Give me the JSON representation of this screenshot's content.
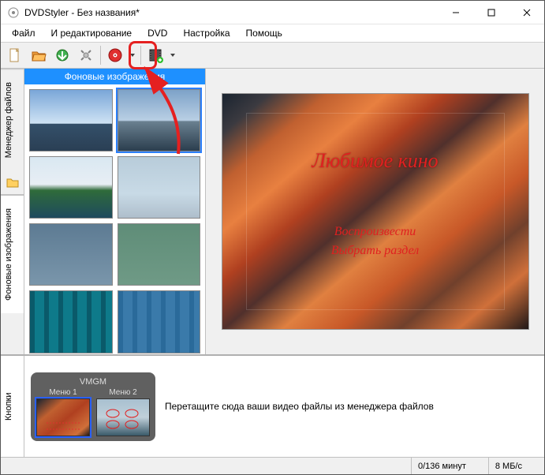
{
  "window": {
    "title": "DVDStyler - Без названия*"
  },
  "menu": {
    "items": [
      "Файл",
      "И редактирование",
      "DVD",
      "Настройка",
      "Помощь"
    ]
  },
  "toolbar": {
    "buttons": [
      {
        "name": "new-project-icon",
        "color": "#f0e0b0"
      },
      {
        "name": "open-project-icon",
        "color": "#f09030"
      },
      {
        "name": "save-project-icon",
        "color": "#40a040"
      },
      {
        "name": "settings-icon",
        "color": "#909090"
      },
      {
        "name": "burn-disc-icon",
        "color": "#d02020"
      },
      {
        "name": "add-video-icon",
        "color": "#505050"
      }
    ]
  },
  "sidebar_tabs": {
    "items": [
      {
        "label": "Менеджер файлов",
        "active": false
      },
      {
        "label": "",
        "active": false,
        "is_icon": true
      },
      {
        "label": "Фоновые изображения",
        "active": true
      },
      {
        "label": "Кнопки",
        "active": false,
        "bottom": true
      }
    ]
  },
  "bg_panel": {
    "header": "Фоновые изображения",
    "thumbs": [
      {
        "name": "sky-clouds",
        "css": "linear-gradient(#7aa6d8 0%,#cfe3f4 55%,#34506a 56%,#2a3f54 100%)",
        "selected": false
      },
      {
        "name": "ship-sea",
        "css": "linear-gradient(#7da2c8 0%,#b9cfe4 50%,#6a8090 52%,#2b3e4e 100%)",
        "selected": true
      },
      {
        "name": "island-green",
        "css": "linear-gradient(#d9e8f2 0%,#e8eef4 45%,#2f6b3a 55%,#1e4a5e 100%)",
        "selected": false
      },
      {
        "name": "clouds-gray",
        "css": "linear-gradient(#b8ccda 0%,#c8dae6 60%,#aebecb 100%)",
        "selected": false
      },
      {
        "name": "blue-gradient",
        "css": "linear-gradient(#5d7b93,#7a96ab)",
        "selected": false
      },
      {
        "name": "green-gradient",
        "css": "linear-gradient(#5f8d78,#6f9a86)",
        "selected": false
      },
      {
        "name": "teal-stripes",
        "css": "repeating-linear-gradient(90deg,#0a5a6a 0 6px,#0e7a8a 6px 18px)",
        "selected": false
      },
      {
        "name": "blue-stripes",
        "css": "repeating-linear-gradient(90deg,#2a6a9a 0 6px,#3a7aaa 6px 18px)",
        "selected": false
      }
    ]
  },
  "preview": {
    "title": "Любимое кино",
    "links": [
      "Воспроизвести",
      "Выбрать раздел"
    ]
  },
  "timeline": {
    "tab_label": "Кнопки",
    "vmgm_label": "VMGM",
    "menus": [
      {
        "label": "Меню 1",
        "selected": true,
        "css": "linear-gradient(140deg,#1a2430,#c06030 30%,#b04020 55%,#d0703a 85%,#201818)"
      },
      {
        "label": "Меню 2",
        "selected": false,
        "css": "linear-gradient(#a8c0d0 0%,#c0d0da 50%,#3a5a6a 100%)"
      }
    ],
    "drop_hint": "Перетащите сюда ваши видео файлы из менеджера файлов"
  },
  "statusbar": {
    "duration": "0/136 минут",
    "bitrate": "8 МБ/с"
  }
}
